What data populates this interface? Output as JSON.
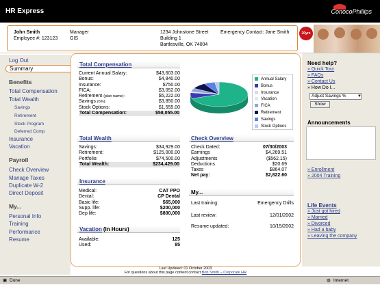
{
  "app": {
    "title": "HR Express",
    "brand": "ConocoPhillips",
    "badge": "20yrs"
  },
  "employee": {
    "name": "John Smith",
    "id_line": "Employee #: 123123",
    "title": "Manager",
    "dept": "GIS",
    "address1": "1234 Johnstone Street",
    "address2": "Building 1",
    "address3": "Bartlesville, OK 74004",
    "emergency": "Emergency Contact: Jane Smith"
  },
  "nav": {
    "logout": "Log Out",
    "summary": "Summary",
    "benefits_head": "Benefits",
    "benefits": [
      "Total Compensation",
      "Total Wealth"
    ],
    "wealth_sub": [
      "Savings",
      "Retirement",
      "Stock Program",
      "Deferred Comp"
    ],
    "benefits2": [
      "Insurance",
      "Vacation"
    ],
    "payroll_head": "Payroll",
    "payroll": [
      "Check Overview",
      "Manage Taxes",
      "Duplicate W-2",
      "Direct Deposit"
    ],
    "my_head": "My...",
    "my": [
      "Personal Info",
      "Training",
      "Performance",
      "Resume"
    ]
  },
  "total_comp": {
    "title": "Total Compensation",
    "rows": [
      {
        "label": "Current Annual Salary:",
        "value": "$43,603.00"
      },
      {
        "label": "Bonus:",
        "value": "$4,840.00"
      },
      {
        "label": "Insurance:",
        "value": "$750.00"
      },
      {
        "label": "FICA:",
        "value": "$3,052.00"
      },
      {
        "label": "Retirement",
        "note": "(plan name):",
        "value": "$5,222.00"
      },
      {
        "label": "Savings",
        "note": "(6%):",
        "value": "$3,850.00"
      },
      {
        "label": "Stock Options:",
        "value": "$1,555.00"
      }
    ],
    "total_label": "Total Compensation:",
    "total_value": "$58,055.00"
  },
  "chart_data": {
    "type": "pie",
    "title": "",
    "series": [
      {
        "name": "Annual Salary",
        "value": 43603,
        "color": "#1fb38a"
      },
      {
        "name": "Bonus",
        "value": 4840,
        "color": "#3a3ab0"
      },
      {
        "name": "Insurance",
        "value": 750,
        "color": "#d9d9f2"
      },
      {
        "name": "Vacation",
        "value": 0,
        "color": "#e6e6e6"
      },
      {
        "name": "FICA",
        "value": 3052,
        "color": "#8fa7d6"
      },
      {
        "name": "Retirement",
        "value": 5222,
        "color": "#0d1550"
      },
      {
        "name": "Savings",
        "value": 3850,
        "color": "#5b80e6"
      },
      {
        "name": "Stock Options",
        "value": 1555,
        "color": "#b8c9f0"
      }
    ],
    "legend_position": "right"
  },
  "total_wealth": {
    "title": "Total Wealth",
    "rows": [
      {
        "label": "Savings:",
        "value": "$34,929.00"
      },
      {
        "label": "Retirement:",
        "value": "$125,000.00"
      },
      {
        "label": "Portfolio:",
        "value": "$74,500.00"
      }
    ],
    "total_label": "Total Wealth:",
    "total_value": "$234,429.00"
  },
  "check": {
    "title": "Check Overview",
    "rows": [
      {
        "label": "Check Dated:",
        "value": "07/30/2003",
        "bold": true
      },
      {
        "label": "Earnings",
        "value": "$4,269.51"
      },
      {
        "label": "Adjustments",
        "value": "($562.15)"
      },
      {
        "label": "Deductions",
        "value": "$20.69"
      },
      {
        "label": "Taxes",
        "value": "$864.07"
      }
    ],
    "net_label": "Net pay:",
    "net_value": "$2,822.60"
  },
  "insurance": {
    "title": "Insurance",
    "rows": [
      {
        "label": "Medical:",
        "value": "CAT PPO"
      },
      {
        "label": "Dental:",
        "value": "CP Dental"
      },
      {
        "label": "Basic life:",
        "value": "$65,000"
      },
      {
        "label": "Supp. life:",
        "value": "$200,000"
      },
      {
        "label": "Dep life:",
        "value": "$800,000"
      }
    ]
  },
  "my": {
    "title": "My...",
    "rows": [
      {
        "label": "Last training:",
        "value": "Emergency Drills"
      },
      {
        "label": "Last review:",
        "value": "12/01/2002"
      },
      {
        "label": "Resume updated:",
        "value": "10/15/2002"
      }
    ]
  },
  "vacation": {
    "title": "Vacation",
    "suffix": "(In Hours)",
    "rows": [
      {
        "label": "Available:",
        "value": "125"
      },
      {
        "label": "Used:",
        "value": "85"
      }
    ]
  },
  "help": {
    "title": "Need help?",
    "links": [
      "Quick Tour",
      "FAQs",
      "Contact Us"
    ],
    "howdo": "How Do I...",
    "select_value": "Adjust Savings %",
    "show": "Show"
  },
  "announcements": {
    "title": "Announcements",
    "links": [
      "Enrollment",
      "2004 Training"
    ]
  },
  "life_events": {
    "title": "Life Events",
    "links": [
      "Just got hired",
      "Married",
      "Divorced",
      "Had a baby",
      "Leaving the company"
    ]
  },
  "footer": {
    "updated": "Last Updated: 01 October 2003",
    "contact_prefix": "For questions about this page content contact ",
    "contact_link": "Bob Smith – Corporate HR"
  },
  "status": {
    "left": "Done",
    "right": "Internet"
  },
  "colors": {
    "accent": "#d98a3a",
    "link": "#2d3e8c",
    "nav_bg": "#eceae0"
  }
}
